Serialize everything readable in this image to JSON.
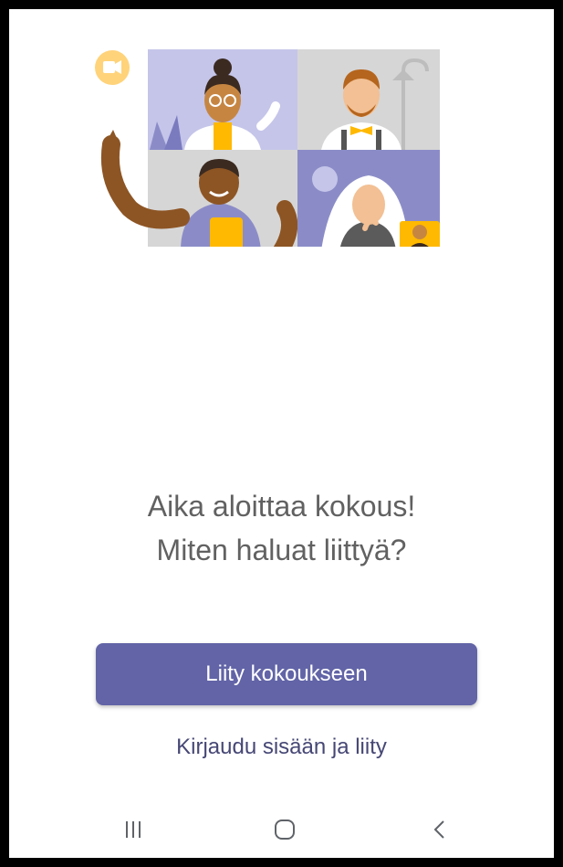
{
  "heading": {
    "line1": "Aika aloittaa kokous!",
    "line2": "Miten haluat liittyä?"
  },
  "actions": {
    "join_label": "Liity kokoukseen",
    "signin_label": "Kirjaudu sisään ja liity"
  },
  "navbar": {
    "recents_icon": "recent-apps-icon",
    "home_icon": "home-icon",
    "back_icon": "back-icon"
  },
  "colors": {
    "accent": "#6264a7",
    "link": "#464775",
    "heading": "#616161",
    "illustration_lilac": "#c5c5ea",
    "illustration_gray": "#d6d6d6",
    "illustration_purple": "#8b8cc7",
    "video_badge": "#ffd37a"
  }
}
